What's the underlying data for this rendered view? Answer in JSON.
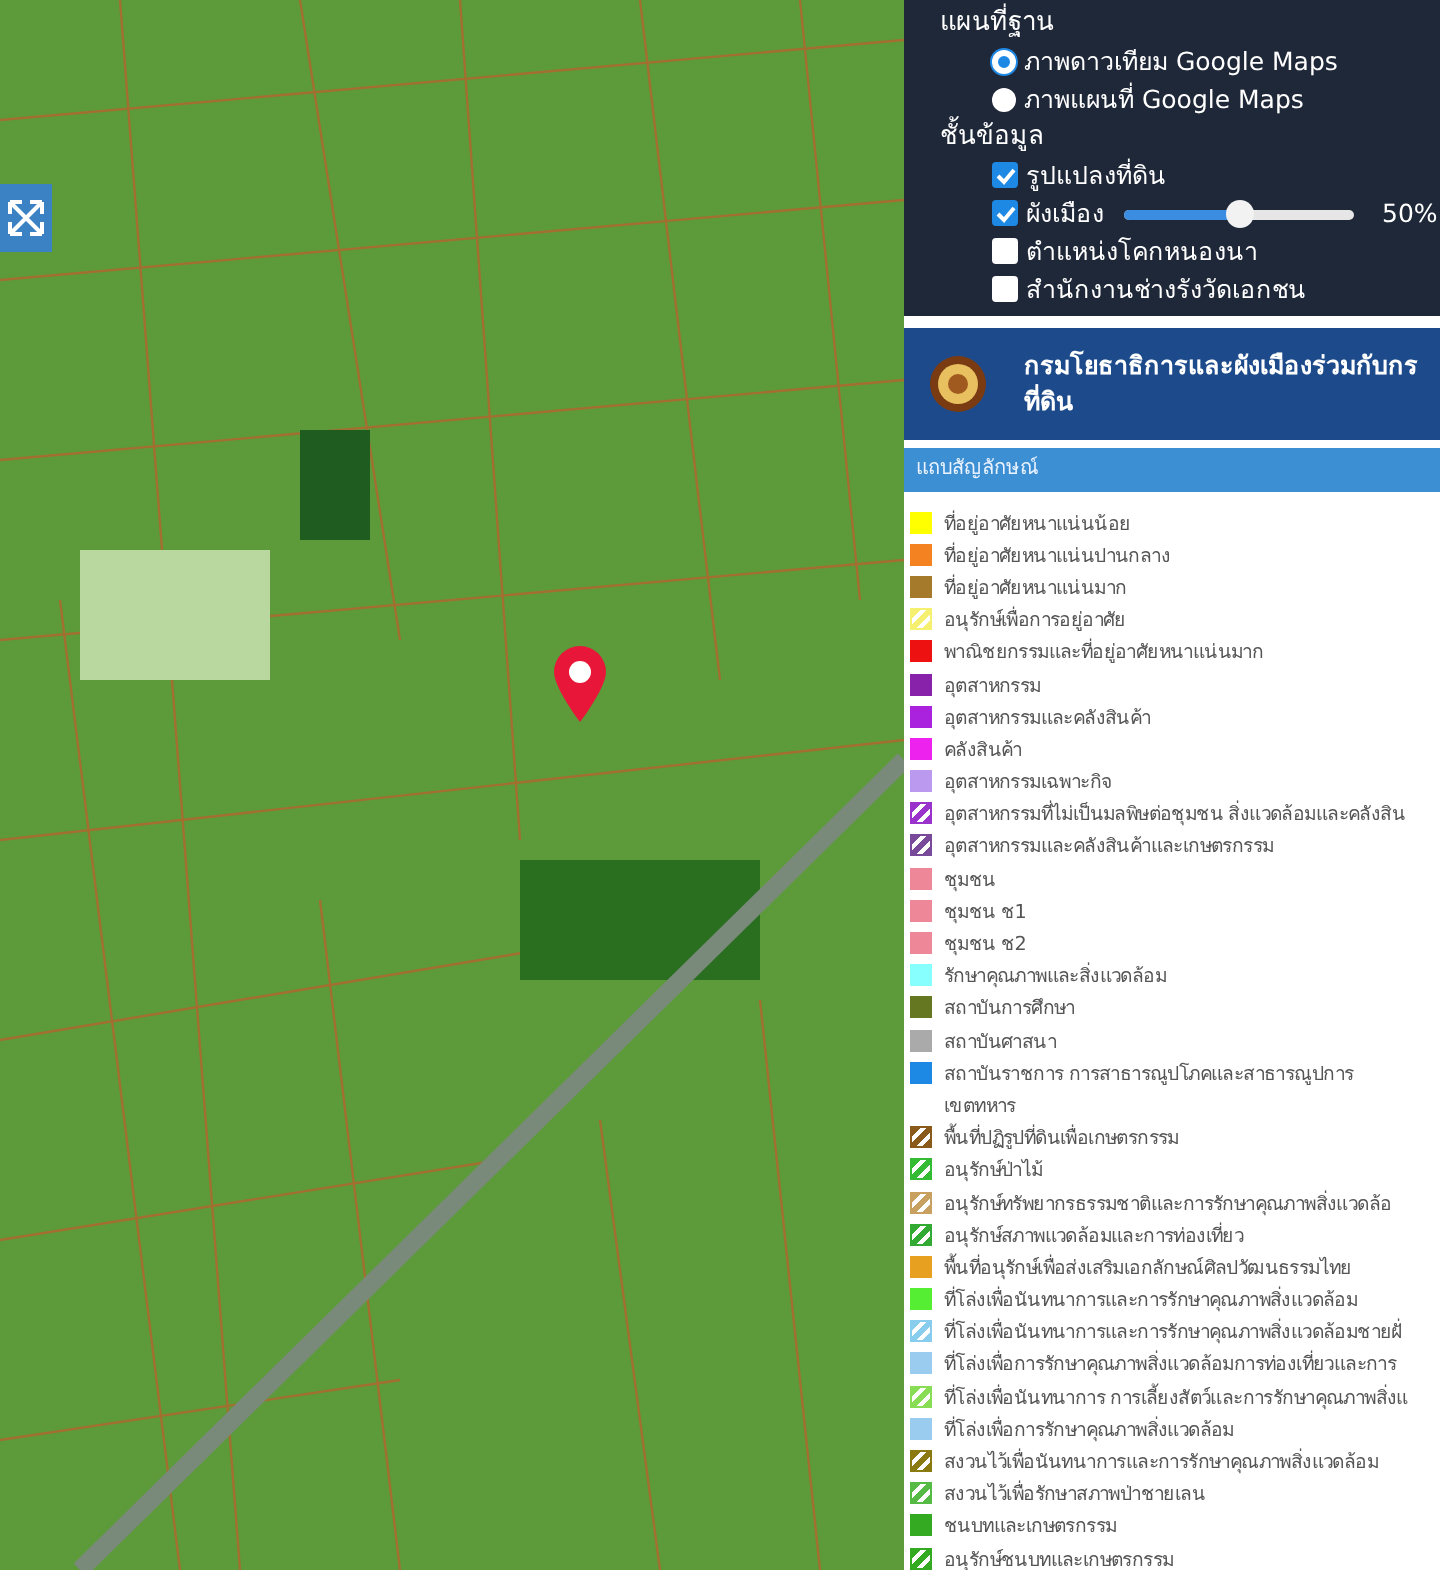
{
  "basemap": {
    "title": "แผนที่ฐาน",
    "options": [
      {
        "label": "ภาพดาวเทียม Google Maps",
        "selected": true
      },
      {
        "label": "ภาพแผนที่ Google Maps",
        "selected": false
      }
    ]
  },
  "layers": {
    "title": "ชั้นข้อมูล",
    "items": [
      {
        "kind": "check",
        "label": "รูปแปลงที่ดิน",
        "checked": true
      },
      {
        "kind": "slider",
        "label": "ผังเมือง",
        "checked": true,
        "level": 0.5,
        "reading": "50%"
      },
      {
        "kind": "check",
        "label": "ตำแหน่งโคกหนองนา",
        "checked": false
      },
      {
        "kind": "check",
        "label": "สำนักงานช่างรังวัดเอกชน",
        "checked": false
      }
    ]
  },
  "agency": {
    "title": "กรมโยธาธิการและผังเมืองร่วมกับกร\nที่ดิน"
  },
  "legend": {
    "title": "แถบสัญลักษณ์",
    "items": [
      {
        "label": "ที่อยู่อาศัยหนาแน่นน้อย",
        "color": "#ffff00",
        "kind": "solid"
      },
      {
        "label": "ที่อยู่อาศัยหนาแน่นปานกลาง",
        "color": "#f58220",
        "kind": "solid"
      },
      {
        "label": "ที่อยู่อาศัยหนาแน่นมาก",
        "color": "#a57a2a",
        "kind": "solid"
      },
      {
        "label": "อนุรักษ์เพื่อการอยู่อาศัย",
        "color": "#f5f070",
        "kind": "hatched"
      },
      {
        "label": "พาณิชยกรรมและที่อยู่อาศัยหนาแน่นมาก",
        "color": "#ee1111",
        "kind": "solid"
      },
      {
        "label": "อุตสาหกรรม",
        "color": "#8822aa",
        "kind": "solid"
      },
      {
        "label": "อุตสาหกรรมและคลังสินค้า",
        "color": "#aa22dd",
        "kind": "solid"
      },
      {
        "label": "คลังสินค้า",
        "color": "#ee22ee",
        "kind": "solid"
      },
      {
        "label": "อุตสาหกรรมเฉพาะกิจ",
        "color": "#bb99ee",
        "kind": "solid"
      },
      {
        "label": "อุตสาหกรรมที่ไม่เป็นมลพิษต่อชุมชน สิ่งแวดล้อมและคลังสิน",
        "color": "#9933cc",
        "kind": "hatched"
      },
      {
        "label": "อุตสาหกรรมและคลังสินค้าและเกษตรกรรม",
        "color": "#7a4a9a",
        "kind": "hatched"
      },
      {
        "label": "ชุมชน",
        "color": "#ee8899",
        "kind": "solid"
      },
      {
        "label": "ชุมชน ช1",
        "color": "#ee8899",
        "kind": "solid"
      },
      {
        "label": "ชุมชน ช2",
        "color": "#ee8899",
        "kind": "solid"
      },
      {
        "label": "รักษาคุณภาพและสิ่งแวดล้อม",
        "color": "#88ffff",
        "kind": "solid"
      },
      {
        "label": "สถาบันการศึกษา",
        "color": "#667722",
        "kind": "solid"
      },
      {
        "label": "สถาบันศาสนา",
        "color": "#aaaaaa",
        "kind": "solid"
      },
      {
        "label": "สถาบันราชการ การสาธารณูปโภคและสาธารณูปการ",
        "color": "#1e88e5",
        "kind": "solid"
      },
      {
        "label": "เขตทหาร",
        "kind": "plain"
      },
      {
        "label": "พื้นที่ปฏิรูปที่ดินเพื่อเกษตรกรรม",
        "color": "#8a5a1a",
        "kind": "hatched"
      },
      {
        "label": "อนุรักษ์ป่าไม้",
        "color": "#33bb33",
        "kind": "hatched"
      },
      {
        "label": "อนุรักษ์ทรัพยากรธรรมชาติและการรักษาคุณภาพสิ่งแวดล้อ",
        "color": "#c8a060",
        "kind": "hatched"
      },
      {
        "label": "อนุรักษ์สภาพแวดล้อมและการท่องเที่ยว",
        "color": "#33aa33",
        "kind": "hatched"
      },
      {
        "label": "พื้นที่อนุรักษ์เพื่อส่งเสริมเอกลักษณ์ศิลปวัฒนธรรมไทย",
        "color": "#e8a020",
        "kind": "solid"
      },
      {
        "label": "ที่โล่งเพื่อนันทนาการและการรักษาคุณภาพสิ่งแวดล้อม",
        "color": "#55ee33",
        "kind": "solid"
      },
      {
        "label": "ที่โล่งเพื่อนันทนาการและการรักษาคุณภาพสิ่งแวดล้อมชายฝั่",
        "color": "#88ccee",
        "kind": "hatched"
      },
      {
        "label": "ที่โล่งเพื่อการรักษาคุณภาพสิ่งแวดล้อมการท่องเที่ยวและการ",
        "color": "#99ccee",
        "kind": "solid"
      },
      {
        "label": "ที่โล่งเพื่อนันทนาการ การเลี้ยงสัตว์และการรักษาคุณภาพสิ่งแ",
        "color": "#88dd55",
        "kind": "hatched"
      },
      {
        "label": "ที่โล่งเพื่อการรักษาคุณภาพสิ่งแวดล้อม",
        "color": "#99ccee",
        "kind": "solid"
      },
      {
        "label": "สงวนไว้เพื่อนันทนาการและการรักษาคุณภาพสิ่งแวดล้อม",
        "color": "#8a7a10",
        "kind": "hatched"
      },
      {
        "label": "สงวนไว้เพื่อรักษาสภาพป่าชายเลน",
        "color": "#55bb44",
        "kind": "hatched"
      },
      {
        "label": "ชนบทและเกษตรกรรม",
        "color": "#33aa22",
        "kind": "solid"
      },
      {
        "label": "อนุรักษ์ชนบทและเกษตรกรรม",
        "color": "#33aa22",
        "kind": "hatched"
      }
    ]
  }
}
